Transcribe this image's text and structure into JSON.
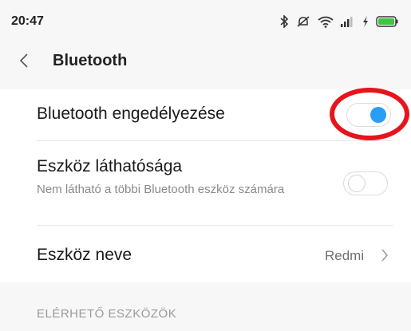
{
  "status_bar": {
    "time": "20:47",
    "icons": [
      "bluetooth-icon",
      "mute-icon",
      "wifi-icon",
      "signal-icon",
      "charging-icon",
      "battery-icon"
    ],
    "battery_color": "#3fc63f"
  },
  "header": {
    "back_icon": "chevron-left-icon",
    "title": "Bluetooth"
  },
  "settings": {
    "bluetooth_enable": {
      "label": "Bluetooth engedélyezése",
      "enabled": true
    },
    "visibility": {
      "label": "Eszköz láthatósága",
      "sublabel": "Nem látható a többi Bluetooth eszköz számára",
      "enabled": false
    },
    "device_name": {
      "label": "Eszköz neve",
      "value": "Redmi",
      "icon": "chevron-right-icon"
    }
  },
  "section": {
    "available_devices": "ELÉRHETŐ ESZKÖZÖK"
  },
  "colors": {
    "toggle_on": "#2a9df4",
    "toggle_off_border": "#d6d6d6",
    "highlight": "#e8141c"
  }
}
